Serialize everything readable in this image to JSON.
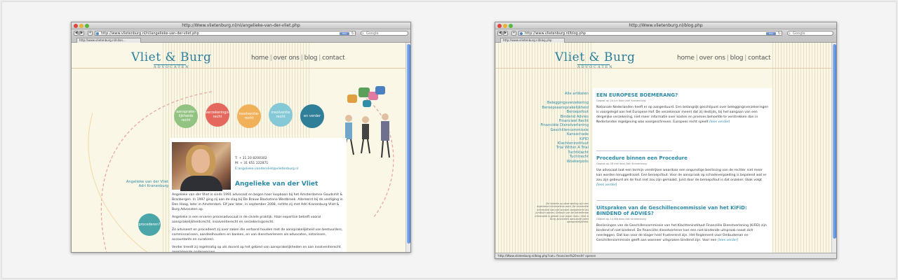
{
  "left_window": {
    "title": "http://Www.vlietenburg.nl/nl/angelieke-van-der-vliet.php",
    "url": "http://www.vlietenburg.nl/nl/angelieke-van-der-vliet.php",
    "tab_label": "http://www.vlietenburg.nl/nl/an...",
    "search_placeholder": "Google",
    "rss": "RSS",
    "logo_main": "Vliet & Burg",
    "logo_sub": "ADVOCATEN",
    "nav": [
      "home",
      "over ons",
      "blog",
      "contact"
    ],
    "bubbles": [
      {
        "label": "aansprake-lijkheids recht",
        "color": "#93c383"
      },
      {
        "label": "verzekerings-recht",
        "color": "#e5685e"
      },
      {
        "label": "insolventie-recht",
        "color": "#f0b15a"
      },
      {
        "label": "insolventie recht",
        "color": "#86c9d6"
      },
      {
        "label": "en verder",
        "color": "#2f7f98"
      }
    ],
    "left_links": [
      "Angelieke van der Vliet",
      "Adri Kranenburg"
    ],
    "procedure_bubble": "procederen?",
    "contact": {
      "t": "T: + 31 20 8200302",
      "m": "M: + 31 651 222871",
      "e": "E:angelieke.vandervliet@vlietenburg.nl"
    },
    "heading": "Angelieke van der Vliet",
    "paragraphs": [
      "Angelieke van der Vliet is sinds 1991 advocaat en begon haar loopbaan bij het Amsterdamse Goudsmit & Branbergen. In 1997 ging zij aan de slag bij De Brauw Blackstone Westbroek. Allereerst bij de vestiging in Den Haag, later in Amsterdam. Elf jaar later, in september 2008, richtte zij met Adri Kranenburg Vliet & Burg Advocaten op.",
      "Angelieke is een ervaren procesadvocaat in de civiele praktijk. Haar expertise betreft vooral aansprakelijkheidsrecht, insolventierecht en verzekeringsrecht.",
      "Zo adviseert en procedeert zij over zaken die verband houden met de aansprakelijkheid van bestuurders, commissarissen, aandeelhouders en banken, en van dienstverleners als advocaten, notarissen, accountants en curatoren.",
      "Verder treedt zij regelmatig op als docent op het gebied van aansprakelijkheden en aan insolventierecht gerelateerde onderwerpen."
    ]
  },
  "right_window": {
    "title": "http://Www.vlietenburg.nl/blog.php",
    "url": "http://www.vlietenburg.nl/blog.php",
    "tab_label": "http://www.vlietenburg.nl/blog.php",
    "search_placeholder": "Google",
    "rss": "RSS",
    "logo_main": "Vliet & Burg",
    "logo_sub": "ADVOCATEN",
    "nav": [
      "home",
      "over ons",
      "blog",
      "contact"
    ],
    "all_articles": "Alle artikelen",
    "categories": [
      "Beleggingsverzekering",
      "Beroepsaansprakelijkheid",
      "Beroepsfout",
      "Bindend Advies",
      "Financieel Recht",
      "Financiële Dienstverlening",
      "Geschillencommissie",
      "Kansschade",
      "KiFiD",
      "Klachteninstituut",
      "Trial Within A Trial",
      "Tuchtklacht",
      "Tuchtrecht",
      "Woekerpolis"
    ],
    "side_note": "De teksten op deze weblog zijn een algemene informatieve aard. De verstrekte informatie kan niet worden aangemerkt als juridisch advies. Gebruik van de betreffende informatie is geheel voor eigen risico. Vliet & Burg advocaten aanvaardt geen aansprakelijkheid.",
    "posts": [
      {
        "title": "EEN EUROPESE BOEMERANG?",
        "meta": "Gepost op 24 jun door Adri Kranenburg",
        "body": "Nationale Nederlanden heeft er op aangestuurd. Een belangrijk geschilpunt over beleggingsverzekeringen is voorgelegd aan het Europese Hof. De verzekeraar meent dat zij destijds, bij het aangaan van een dergelijke verzekering, niet meer informatie over kosten en premies behoefde te verstrekken dan in Nederlandse regelgeving was voorgeschreven. Europees recht speelt",
        "more": "[lees verder]"
      },
      {
        "title": "Procedure binnen een Procedure",
        "meta": "Gepost op 28 mei door Adri Kranenburg",
        "body": "Uw advocaat laat een termijn verstrijken waardoor een ongunstige beslissing van de rechter niet meer kan worden teruggedraaid. Een beroepsfout. Voor de aanspraak op schadevergoeding is bepalend wat er zou zijn gebeurd als de fout niet zou zijn gemaakt. Juist door de beroepsfout is dat onzeker. Vaak volgt",
        "more": "[lees verder]"
      },
      {
        "title": "Uitspraken van de Geschillencommissie van het KiFiD: BINDEND of ADVIES?",
        "meta": "Gepost op 14 feb door Adri Kranenburg",
        "body": "Beslissingen van de Geschillencommissie van het Klachteninstituut Financiële Dienstverlening (KiFiD) zijn bindend of niet bindend. De financiële dienstverlener kan een niet bindende uitspraak naast zich neerleggen. Dat kan voor de klager heel frustrerend zijn. Het Reglement voor Ombudsman en Geschillencommissie geeft aan wanneer uitspraken bindend zijn. Voor een",
        "more": "[lees verder]"
      }
    ],
    "status": "'http://Www.vlietenburg.nl/blog.php?cat= financieel%20recht' openen"
  }
}
